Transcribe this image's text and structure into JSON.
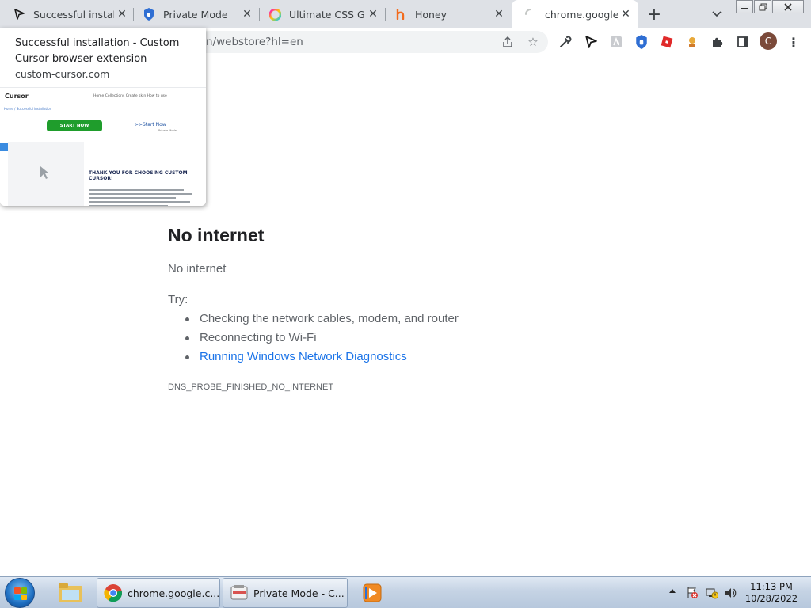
{
  "browser": {
    "tabs": [
      {
        "title": "Successful installa",
        "icon": "custom-cursor-icon"
      },
      {
        "title": "Private Mode",
        "icon": "private-mode-icon"
      },
      {
        "title": "Ultimate CSS Grac",
        "icon": "css-gradient-icon"
      },
      {
        "title": "Honey",
        "icon": "honey-icon"
      },
      {
        "title": "chrome.google.cc",
        "icon": "loading-spinner-icon",
        "active": true
      }
    ],
    "new_tab_label": "+",
    "url": "n/webstore?hl=en",
    "avatar_initial": "C"
  },
  "hover_preview": {
    "title": "Successful installation - Custom Cursor browser extension",
    "domain": "custom-cursor.com",
    "thumbnail": {
      "logo": "Cursor",
      "nav": "Home   Collections   Create skin   How to use",
      "breadcrumb": "Home / Successful installation",
      "start_button": "START NOW",
      "start_link": ">>Start Now",
      "start_sub": "Private Mode",
      "heading": "THANK YOU FOR CHOOSING CUSTOM CURSOR!"
    }
  },
  "error_page": {
    "title": "No internet",
    "message": "No internet",
    "try_label": "Try:",
    "suggestions": [
      "Checking the network cables, modem, and router",
      "Reconnecting to Wi-Fi",
      "Running Windows Network Diagnostics"
    ],
    "error_code": "DNS_PROBE_FINISHED_NO_INTERNET"
  },
  "taskbar": {
    "tasks": [
      {
        "label": "chrome.google.c...",
        "icon": "chrome-icon"
      },
      {
        "label": "Private Mode - C...",
        "icon": "paint-icon"
      }
    ],
    "time": "11:13 PM",
    "date": "10/28/2022"
  },
  "colors": {
    "link": "#1a73e8",
    "text": "#5f6368",
    "title": "#202124",
    "tabstrip": "#dee1e6"
  }
}
